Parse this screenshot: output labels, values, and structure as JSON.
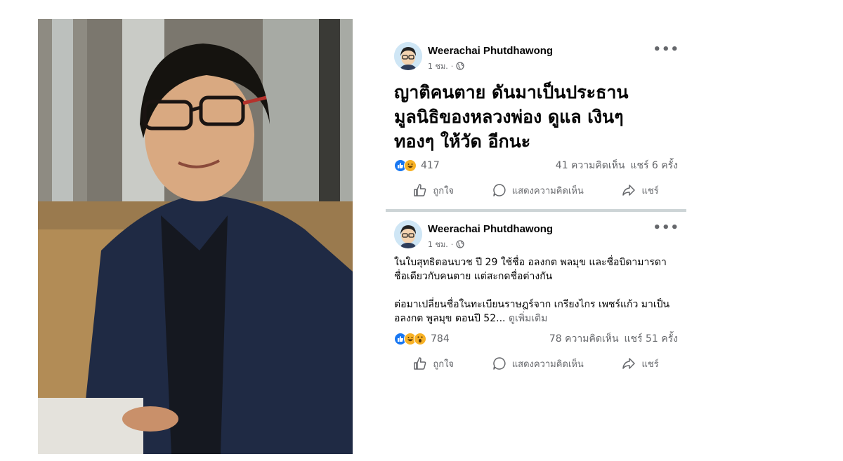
{
  "photo": {
    "description_icon": "portrait-photo"
  },
  "posts": [
    {
      "author": "Weerachai Phutdhawong",
      "time": "1 ชม.",
      "separator": "·",
      "headline_lines": [
        "ญาติคนตาย ดันมาเป็นประธาน",
        "มูลนิธิของหลวงพ่อง ดูแล เงินๆ",
        "ทองๆ ให้วัด อีกนะ"
      ],
      "reaction_count": "417",
      "comments": "41 ความคิดเห็น",
      "shares": "แชร์ 6 ครั้ง",
      "actions": {
        "like": "ถูกใจ",
        "comment": "แสดงความคิดเห็น",
        "share": "แชร์"
      }
    },
    {
      "author": "Weerachai Phutdhawong",
      "time": "1 ชม.",
      "separator": "·",
      "paragraph1_lines": [
        "ในใบสุทธิตอนบวช ปี 29 ใช้ชื่อ อลงกต พลมุข และชื่อบิดามารดา",
        "ชื่อเดียวกับคนตาย แต่สะกดชื่อต่างกัน"
      ],
      "paragraph2_lines": [
        "ต่อมาเปลี่ยนชื่อในทะเบียนราษฎร์จาก เกรียงไกร เพชร์แก้ว มาเป็น",
        "อลงกต พูลมุข ตอนปี 52..."
      ],
      "see_more": "ดูเพิ่มเติม",
      "reaction_count": "784",
      "comments": "78 ความคิดเห็น",
      "shares": "แชร์ 51 ครั้ง",
      "actions": {
        "like": "ถูกใจ",
        "comment": "แสดงความคิดเห็น",
        "share": "แชร์"
      }
    }
  ],
  "colors": {
    "accent": "#1877f2",
    "muted": "#65676b",
    "divider": "#cdd4d6"
  }
}
